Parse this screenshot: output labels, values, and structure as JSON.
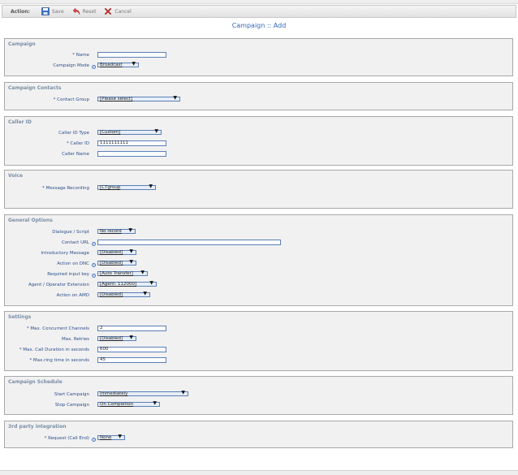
{
  "toolbar": {
    "action_label": "Action:",
    "save_label": "Save",
    "reset_label": "Reset",
    "cancel_label": "Cancel"
  },
  "page_title": "Campaign :: Add",
  "sections": {
    "campaign": {
      "title": "Campaign",
      "name_label": "* Name",
      "name_value": "",
      "mode_label": "Campaign Mode",
      "mode_value": "Broadcast"
    },
    "contacts": {
      "title": "Campaign Contacts",
      "group_label": "* Contact Group",
      "group_value": "[Please select]"
    },
    "caller_id": {
      "title": "Caller ID",
      "type_label": "Caller ID Type",
      "type_value": "[Custom]",
      "id_label": "* Caller ID",
      "id_value": "1111111111",
      "name_label": "Caller Name",
      "name_value": ""
    },
    "voice": {
      "title": "Voice",
      "recording_label": "* Message Recording",
      "recording_value": "[CTgroup"
    },
    "general": {
      "title": "General Options",
      "script_label": "Dialogue / Script",
      "script_value": "No record",
      "contact_url_label": "Contact URL",
      "contact_url_value": "",
      "intro_label": "Introductory Message",
      "intro_value": "[Disabled]",
      "dnc_label": "Action on DNC",
      "dnc_value": "[Disabled]",
      "input_key_label": "Required input key",
      "input_key_value": "[Auto Transfer]",
      "extension_label": "Agent / Operator Extension",
      "extension_value": "[Agent: 112000]",
      "amd_label": "Action on AMD",
      "amd_value": "[Disabled]"
    },
    "settings": {
      "title": "Settings",
      "channels_label": "* Max. Concurrent Channels",
      "channels_value": "2",
      "retries_label": "Max. Retries",
      "retries_value": "[Disabled]",
      "duration_label": "* Max. Call Duration in seconds",
      "duration_value": "600",
      "ring_label": "* Max.ring time in seconds",
      "ring_value": "45"
    },
    "schedule": {
      "title": "Campaign Schedule",
      "start_label": "Start Campaign",
      "start_value": "Immediately",
      "stop_label": "Stop Campaign",
      "stop_value": "On Completion"
    },
    "integration": {
      "title": "3rd party integration",
      "request_label": "* Request (Call End)",
      "request_value": "None"
    }
  },
  "help_glyph": "?",
  "arrow_glyph": "▼"
}
